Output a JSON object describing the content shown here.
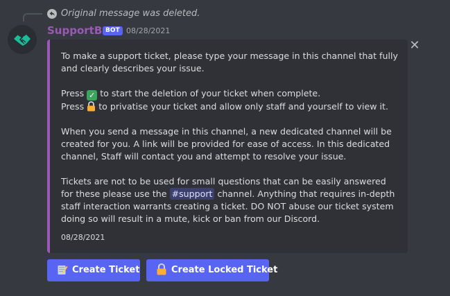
{
  "reply": {
    "icon": "reply-icon",
    "text": "Original message was deleted."
  },
  "author": {
    "avatar_icon": "handshake-icon",
    "name": "SupportBot",
    "name_color": "#9b59b6",
    "badge": "BOT",
    "timestamp": "08/28/2021"
  },
  "embed": {
    "accent_color": "#9b59b6",
    "close_icon": "close-icon",
    "close_label": "✕",
    "p1": "To make a support ticket, please type your message in this channel that fully and clearly describes your issue.",
    "line_check_pre": "Press",
    "check_icon": "check-mark-emoji-icon",
    "line_check_post": "to start the deletion of your ticket when complete.",
    "line_lock_pre": "Press",
    "lock_icon": "lock-emoji-icon",
    "line_lock_post": "to privatise your ticket and allow only staff and yourself to view it.",
    "p3": "When you send a message in this channel, a new dedicated channel will be created for you. A link will be provided for ease of access. In this dedicated channel, Staff will contact you and attempt to resolve your issue.",
    "p4_pre": "Tickets are not to be used for small questions that can be easily answered for these please use the",
    "channel_mention": "#support",
    "p4_post": "channel. Anything that requires in-depth staff interaction warrants creating a ticket. DO NOT abuse our ticket system doing so will result in a mute, kick or ban from our Discord.",
    "footer": "08/28/2021"
  },
  "buttons": [
    {
      "label": "Create Ticket",
      "icon": "memo-emoji-icon"
    },
    {
      "label": "Create Locked Ticket",
      "icon": "lock-emoji-icon"
    }
  ],
  "colors": {
    "background": "#36393f",
    "embed_bg": "#2f3136",
    "button": "#5865f2",
    "text": "#dcddde"
  }
}
